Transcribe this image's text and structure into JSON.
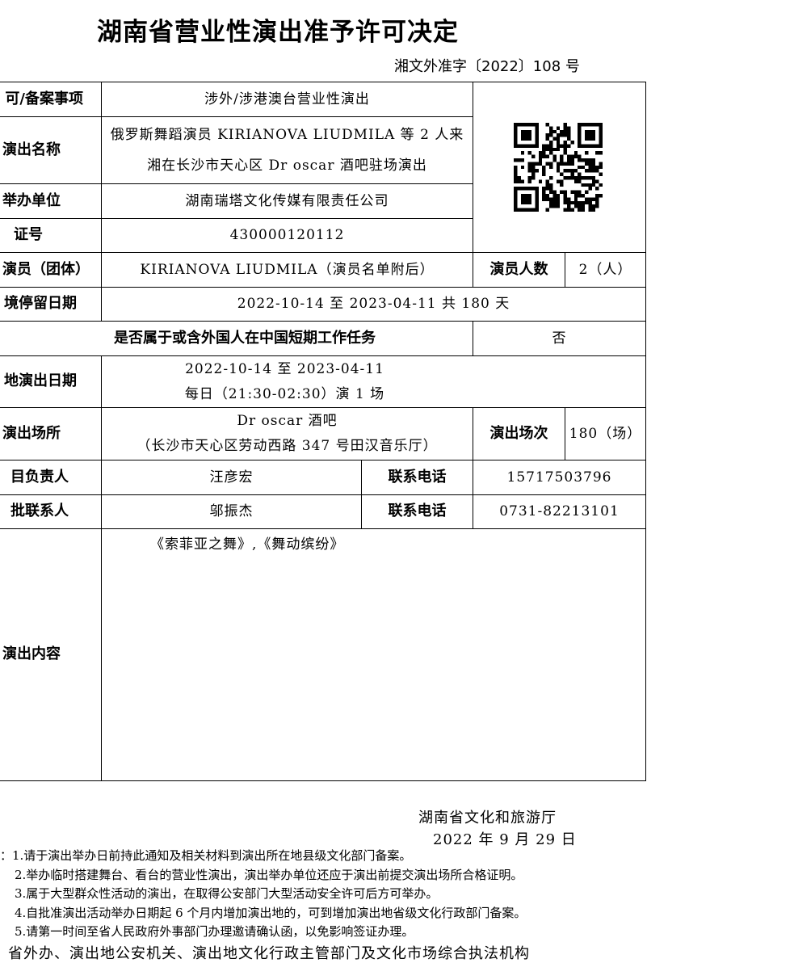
{
  "title": "湖南省营业性演出准予许可决定",
  "doc_number": "湘文外准字〔2022〕108 号",
  "qr_code_icon": "qr-code",
  "table": {
    "item_label": "可/备案事项",
    "item_value": "涉外/涉港澳台营业性演出",
    "show_name_label": "演出名称",
    "show_name_line1": "俄罗斯舞蹈演员 KIRIANOVA LIUDMILA 等 2 人来",
    "show_name_line2": "湘在长沙市天心区 Dr oscar 酒吧驻场演出",
    "organizer_label": "举办单位",
    "organizer_value": "湖南瑞塔文化传媒有限责任公司",
    "license_label": "证号",
    "license_value": "430000120112",
    "performer_label": "演员（团体）",
    "performer_value": "KIRIANOVA LIUDMILA（演员名单附后）",
    "performer_count_label": "演员人数",
    "performer_count_value": "2（人）",
    "stay_label": "境停留日期",
    "stay_value": "2022-10-14 至 2023-04-11 共 180 天",
    "foreign_work_label": "是否属于或含外国人在中国短期工作任务",
    "foreign_work_value": "否",
    "local_date_label": "地演出日期",
    "local_date_line1": "2022-10-14 至 2023-04-11",
    "local_date_line2": "每日（21:30-02:30）演 1 场",
    "venue_label": "演出场所",
    "venue_line1": "Dr oscar 酒吧",
    "venue_line2": "（长沙市天心区劳动西路 347 号田汉音乐厅）",
    "sessions_label": "演出场次",
    "sessions_value": "180（场）",
    "manager_label": "目负责人",
    "manager_value": "汪彦宏",
    "manager_phone_label": "联系电话",
    "manager_phone_value": "15717503796",
    "approval_contact_label": "批联系人",
    "approval_contact_value": "邬振杰",
    "approval_phone_label": "联系电话",
    "approval_phone_value": "0731-82213101",
    "content_label": "演出内容",
    "content_value": "《索菲亚之舞》,《舞动缤纷》"
  },
  "issuer": "湖南省文化和旅游厅",
  "issue_date": "2022 年 9 月 29 日",
  "notes": [
    "：1.请于演出举办日前持此通知及相关材料到演出所在地县级文化部门备案。",
    "2.举办临时搭建舞台、看台的营业性演出，演出举办单位还应于演出前提交演出场所合格证明。",
    "3.属于大型群众性活动的演出，在取得公安部门大型活动安全许可后方可举办。",
    "4.自批准演出活动举办日期起 6 个月内增加演出地的，可到增加演出地省级文化行政部门备案。",
    "5.请第一时间至省人民政府外事部门办理邀请确认函，以免影响签证办理。"
  ],
  "cc_line": "省外办、演出地公安机关、演出地文化行政主管部门及文化市场综合执法机构"
}
